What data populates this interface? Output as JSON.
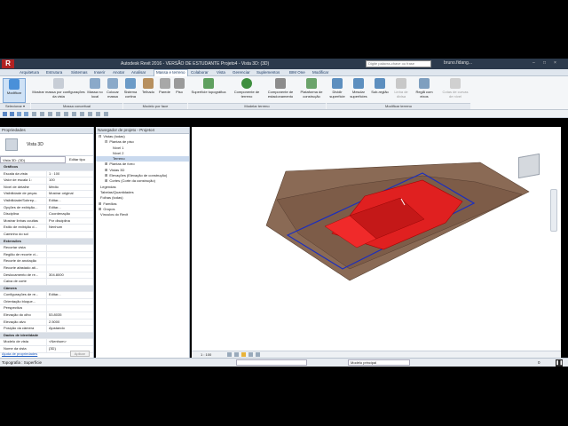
{
  "window": {
    "title": "Autodesk Revit 2016 - VERSÃO DE ESTUDANTE    Projeto4 - Vista 3D: (3D)",
    "search_placeholder": "Digite palavra-chave ou frase",
    "user": "bruno.fidang...",
    "controls": [
      "–",
      "□",
      "×"
    ]
  },
  "menu_tabs": [
    "Arquitetura",
    "Estrutura",
    "Sistemas",
    "Inserir",
    "Anotar",
    "Analisar",
    "Massa e terreno",
    "Colaborar",
    "Vista",
    "Gerenciar",
    "Suplementos",
    "BIM One",
    "Modificar"
  ],
  "active_tab": "Massa e terreno",
  "ribbon": {
    "buttons": [
      {
        "label": "Modificar",
        "color": "#4a90d9"
      },
      {
        "label": "Mostrar massa por configurações da vista",
        "color": "#c7cdd6"
      },
      {
        "label": "Massa no local",
        "color": "#8aa9c9"
      },
      {
        "label": "Colocar massa",
        "color": "#8aa9c9"
      },
      {
        "label": "Sistema cortina",
        "color": "#6c9bc7"
      },
      {
        "label": "Telhado",
        "color": "#b7905f"
      },
      {
        "label": "Parede",
        "color": "#a8a8a8"
      },
      {
        "label": "Piso",
        "color": "#9a9a9a"
      },
      {
        "label": "Superfície topográfica",
        "color": "#5fa05f"
      },
      {
        "label": "Componente de terreno",
        "color": "#3e8e3e"
      },
      {
        "label": "Componente de estacionamento",
        "color": "#8c8c8c"
      },
      {
        "label": "Plataforma de construção",
        "color": "#6ba36b"
      },
      {
        "label": "Dividir superfície",
        "color": "#5d8fbf"
      },
      {
        "label": "Mesclar superfícies",
        "color": "#5d8fbf"
      },
      {
        "label": "Sub-região",
        "color": "#5d8fbf"
      },
      {
        "label": "Linha de divisa",
        "color": "#c8c8c8"
      },
      {
        "label": "Regiã com eixos",
        "color": "#7f9fbf"
      },
      {
        "label": "Cotas de curvas de nível",
        "color": "#d0d0d0"
      }
    ],
    "panels": [
      "Selecionar ▾",
      "Massa conceitual",
      "Modelo por face",
      "Modelar terreno",
      "Modificar terreno"
    ]
  },
  "properties": {
    "title": "Propriedades",
    "type_name": "Vista 3D",
    "view_selector": "Vista 3D: (3D)",
    "edit_type": "Editar tipo",
    "rows": [
      {
        "k": "Gráficos",
        "v": "",
        "section": true
      },
      {
        "k": "Escala da vista",
        "v": "1 : 100"
      },
      {
        "k": "Valor de escala 1:",
        "v": "100"
      },
      {
        "k": "Nível de detalhe",
        "v": "Médio"
      },
      {
        "k": "Visibilidade de peças",
        "v": "Mostrar original"
      },
      {
        "k": "Visibilidade/Sobrep...",
        "v": "Editar..."
      },
      {
        "k": "Opções de exibição...",
        "v": "Editar..."
      },
      {
        "k": "Disciplina",
        "v": "Coordenação"
      },
      {
        "k": "Mostrar linhas ocultas",
        "v": "Por disciplina"
      },
      {
        "k": "Estilo de exibição d...",
        "v": "Nenhum"
      },
      {
        "k": "Caminho do sol",
        "v": ""
      },
      {
        "k": "Extensões",
        "v": "",
        "section": true
      },
      {
        "k": "Recortar vista",
        "v": ""
      },
      {
        "k": "Região de recorte vi...",
        "v": ""
      },
      {
        "k": "Recorte de anotação",
        "v": ""
      },
      {
        "k": "Recorte afastado ati...",
        "v": ""
      },
      {
        "k": "Deslocamento de re...",
        "v": "304.8000"
      },
      {
        "k": "Caixa de corte",
        "v": ""
      },
      {
        "k": "Câmera",
        "v": "",
        "section": true
      },
      {
        "k": "Configurações de re...",
        "v": "Editar..."
      },
      {
        "k": "Orientação bloque...",
        "v": ""
      },
      {
        "k": "Perspectiva",
        "v": ""
      },
      {
        "k": "Elevação do olho",
        "v": "53.8035"
      },
      {
        "k": "Elevação alvo",
        "v": "2.5000"
      },
      {
        "k": "Posição da câmera",
        "v": "Ajustando"
      },
      {
        "k": "Dados de identidade",
        "v": "",
        "section": true
      },
      {
        "k": "Modelo de vista",
        "v": "<Nenhum>"
      },
      {
        "k": "Nome da vista",
        "v": "{3D}"
      }
    ],
    "help_link": "Ajuda de propriedades",
    "apply": "Aplicar"
  },
  "project_browser": {
    "title": "Navegador de projeto - Projeto4",
    "items": [
      {
        "label": "Vistas (todas)",
        "level": 0,
        "sign": "⊟"
      },
      {
        "label": "Plantas de piso",
        "level": 1,
        "sign": "⊟"
      },
      {
        "label": "Nível 1",
        "level": 2,
        "sign": ""
      },
      {
        "label": "Nível 2",
        "level": 2,
        "sign": ""
      },
      {
        "label": "Terreno",
        "level": 2,
        "sign": "",
        "selected": true
      },
      {
        "label": "Plantas de forro",
        "level": 1,
        "sign": "⊞"
      },
      {
        "label": "Vistas 3D",
        "level": 1,
        "sign": "⊞"
      },
      {
        "label": "Elevações (Elevação de construção)",
        "level": 1,
        "sign": "⊞"
      },
      {
        "label": "Cortes (Corte da construção)",
        "level": 1,
        "sign": "⊞"
      },
      {
        "label": "Legendas",
        "level": 0,
        "sign": ""
      },
      {
        "label": "Tabelas/Quantidades",
        "level": 0,
        "sign": ""
      },
      {
        "label": "Folhas (todas)",
        "level": 0,
        "sign": ""
      },
      {
        "label": "Famílias",
        "level": 0,
        "sign": "⊞"
      },
      {
        "label": "Grupos",
        "level": 0,
        "sign": "⊞"
      },
      {
        "label": "Vínculos do Revit",
        "level": 0,
        "sign": ""
      }
    ]
  },
  "view_bar": {
    "scale": "1 : 100"
  },
  "status": {
    "left": "Topografia : Superfície",
    "model": "Modelo principal",
    "sel_count": "0"
  },
  "colors": {
    "accent": "#2c3a4c",
    "terrain": "#7a5a48",
    "building": "#e02020",
    "boundary": "#1a2ec0"
  }
}
